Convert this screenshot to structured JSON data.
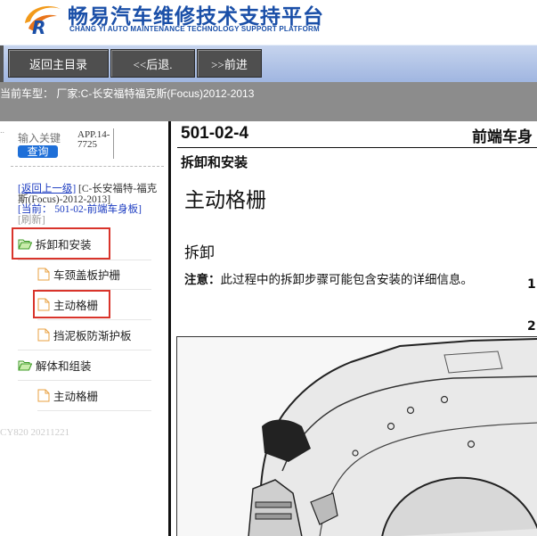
{
  "header": {
    "title_cn": "畅易汽车维修技术支持平台",
    "title_en": "CHANG YI AUTO MAINTENANCE TECHNOLOGY SUPPORT PLATFORM",
    "logo_icon": "cy-logo-icon"
  },
  "nav": {
    "home_label": "返回主目录",
    "back_label": "<<后退.",
    "forward_label": ">>前进"
  },
  "model_bar": {
    "text": "当前车型： 厂家:C-长安福特福克斯(Focus)2012-2013"
  },
  "left": {
    "search_placeholder": "输入关键",
    "search_button": "查询",
    "app_code": "APP.14-7725",
    "breadcrumb": {
      "up_link": "[返回上一级]",
      "parent": "[C-长安福特-福克斯(Focus)-2012-2013]",
      "current_prefix": "[当前：",
      "current_value": "501-02-前端车身板]",
      "refresh": "[刷新]"
    },
    "tree": [
      {
        "label": "拆卸和安装",
        "type": "folder"
      },
      {
        "label": "车颈盖板护栅",
        "type": "file"
      },
      {
        "label": "主动格栅",
        "type": "file"
      },
      {
        "label": "挡泥板防渐护板",
        "type": "file"
      },
      {
        "label": "解体和组装",
        "type": "folder"
      },
      {
        "label": "主动格栅",
        "type": "file"
      }
    ],
    "version": "CY820 20211221"
  },
  "doc": {
    "code": "501-02-4",
    "section": "前端车身",
    "subtitle": "拆卸和安装",
    "heading": "主动格栅",
    "subheading": "拆卸",
    "note_label": "注意：",
    "note_text": "此过程中的拆卸步骤可能包含安装的详细信息。",
    "step1": "1.",
    "step2": "2"
  },
  "colors": {
    "title_blue": "#1a4fa8",
    "nav_button": "#4f4f4f",
    "model_bar": "#8c8c8c",
    "highlight_red": "#d9342b",
    "link_blue": "#1a3ac0",
    "search_button": "#1e6fd8"
  }
}
